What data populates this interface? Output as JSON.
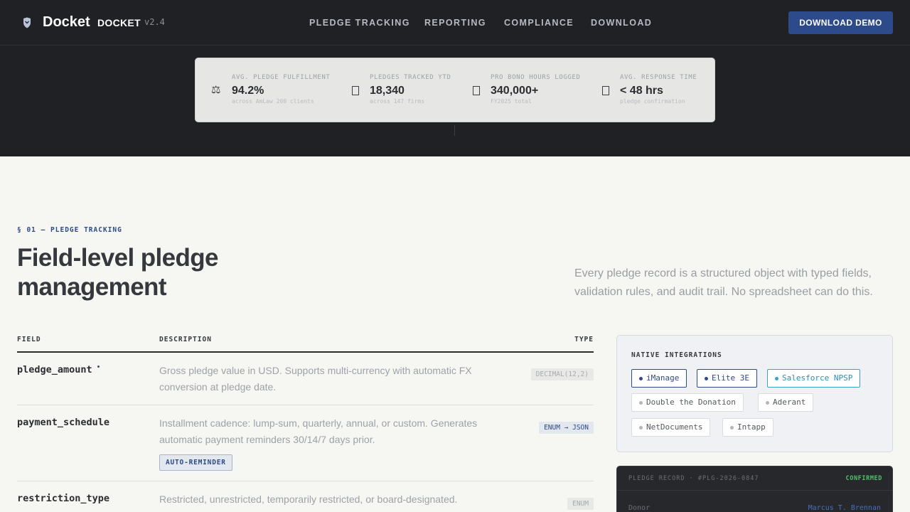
{
  "header": {
    "brand_name": "Docket",
    "brand_tag": "DOCKET",
    "version": "v2.4",
    "nav": [
      "PLEDGE TRACKING",
      "REPORTING",
      "COMPLIANCE",
      "DOWNLOAD"
    ],
    "cta_label": "DOWNLOAD DEMO"
  },
  "stats": [
    {
      "icon": "scales-icon",
      "label": "AVG. PLEDGE FULFILLMENT",
      "value": "94.2%",
      "sub": "across AmLaw 200 clients"
    },
    {
      "icon": "document-icon",
      "label": "PLEDGES TRACKED YTD",
      "value": "18,340",
      "sub": "across 147 firms"
    },
    {
      "icon": "clock-icon",
      "label": "PRO BONO HOURS LOGGED",
      "value": "340,000+",
      "sub": "FY2025 total"
    },
    {
      "icon": "check-icon",
      "label": "AVG. RESPONSE TIME",
      "value": "< 48 hrs",
      "sub": "pledge confirmation"
    }
  ],
  "section": {
    "eyebrow": "§ 01 — PLEDGE TRACKING",
    "title": "Field-level pledge management",
    "description": "Every pledge record is a structured object with typed fields, validation rules, and audit trail. No spreadsheet can do this."
  },
  "table": {
    "headers": {
      "field": "FIELD",
      "description": "DESCRIPTION",
      "type": "TYPE"
    },
    "rows": [
      {
        "field": "pledge_amount",
        "description": "Gross pledge value in USD. Supports multi-currency with automatic FX conversion at pledge date.",
        "type": "DECIMAL(12,2)"
      },
      {
        "field": "payment_schedule",
        "description": "Installment cadence: lump-sum, quarterly, annual, or custom. Generates automatic payment reminders 30/14/7 days prior.",
        "type": "ENUM → JSON",
        "tag": "AUTO-REMINDER"
      },
      {
        "field": "restriction_type",
        "description": "Restricted, unrestricted, temporarily restricted, or board-designated. Drives FASB ASC",
        "type": "ENUM"
      }
    ]
  },
  "integrations": {
    "title": "NATIVE INTEGRATIONS",
    "items": [
      "iManage",
      "Elite 3E",
      "Salesforce NPSP",
      "Double the Donation",
      "Aderant",
      "NetDocuments",
      "Intapp"
    ]
  },
  "record": {
    "label": "PLEDGE RECORD · #PLG-2026-0847",
    "status": "CONFIRMED",
    "key": "Donor",
    "value": "Marcus T. Brennan"
  },
  "colors": {
    "accent": "#2d4a8a",
    "dark_bg": "#1f2125",
    "page_bg": "#f6f6f3",
    "success": "#4cc36a",
    "teal": "#3aa3c5"
  }
}
